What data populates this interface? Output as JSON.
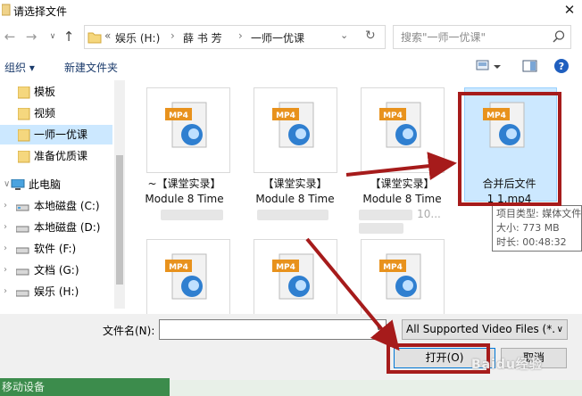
{
  "window": {
    "title": "请选择文件"
  },
  "nav": {
    "path": [
      "娱乐 (H:)",
      "薛 书 芳",
      "一师一优课"
    ],
    "path_prefix": "«",
    "search_placeholder": "搜索\"一师一优课\""
  },
  "toolbar": {
    "organize": "组织 ▾",
    "new_folder": "新建文件夹"
  },
  "sidebar": {
    "items": [
      {
        "label": "模板",
        "icon": "folder-icon",
        "selected": false
      },
      {
        "label": "视频",
        "icon": "folder-icon",
        "selected": false
      },
      {
        "label": "一师一优课",
        "icon": "folder-icon",
        "selected": true
      },
      {
        "label": "准备优质课",
        "icon": "folder-icon",
        "selected": false
      },
      {
        "label": "此电脑",
        "icon": "computer-icon",
        "selected": false
      },
      {
        "label": "本地磁盘 (C:)",
        "icon": "drive-icon",
        "selected": false
      },
      {
        "label": "本地磁盘 (D:)",
        "icon": "drive-icon",
        "selected": false
      },
      {
        "label": "软件 (F:)",
        "icon": "drive-icon",
        "selected": false
      },
      {
        "label": "文档 (G:)",
        "icon": "drive-icon",
        "selected": false
      },
      {
        "label": "娱乐 (H:)",
        "icon": "drive-icon",
        "selected": false
      }
    ]
  },
  "files": [
    {
      "line1": "~【课堂实录】",
      "line2": "Module 8 Time",
      "badge": "MP4"
    },
    {
      "line1": "【课堂实录】",
      "line2": "Module 8 Time",
      "badge": "MP4"
    },
    {
      "line1": "【课堂实录】",
      "line2": "Module 8 Time",
      "line3": "10...",
      "badge": "MP4"
    },
    {
      "line1": "合并后文件",
      "line2": "1 1.mp4",
      "badge": "MP4"
    },
    {
      "badge": "MP4"
    },
    {
      "badge": "MP4"
    },
    {
      "badge": "MP4"
    }
  ],
  "tooltip": {
    "type": "项目类型: 媒体文件",
    "size": "大小: 773 MB",
    "duration": "时长: 00:48:32"
  },
  "bottom": {
    "filename_label": "文件名(N):",
    "filename_value": "",
    "filter": "All Supported Video Files (*.",
    "open": "打开(O)",
    "cancel": "取消"
  },
  "taskbar": {
    "text": "移动设备"
  },
  "watermark": "Baidu经验",
  "colors": {
    "highlight_red": "#a61b1b",
    "selection_blue": "#cce8ff",
    "link_blue": "#1a3a6b"
  }
}
